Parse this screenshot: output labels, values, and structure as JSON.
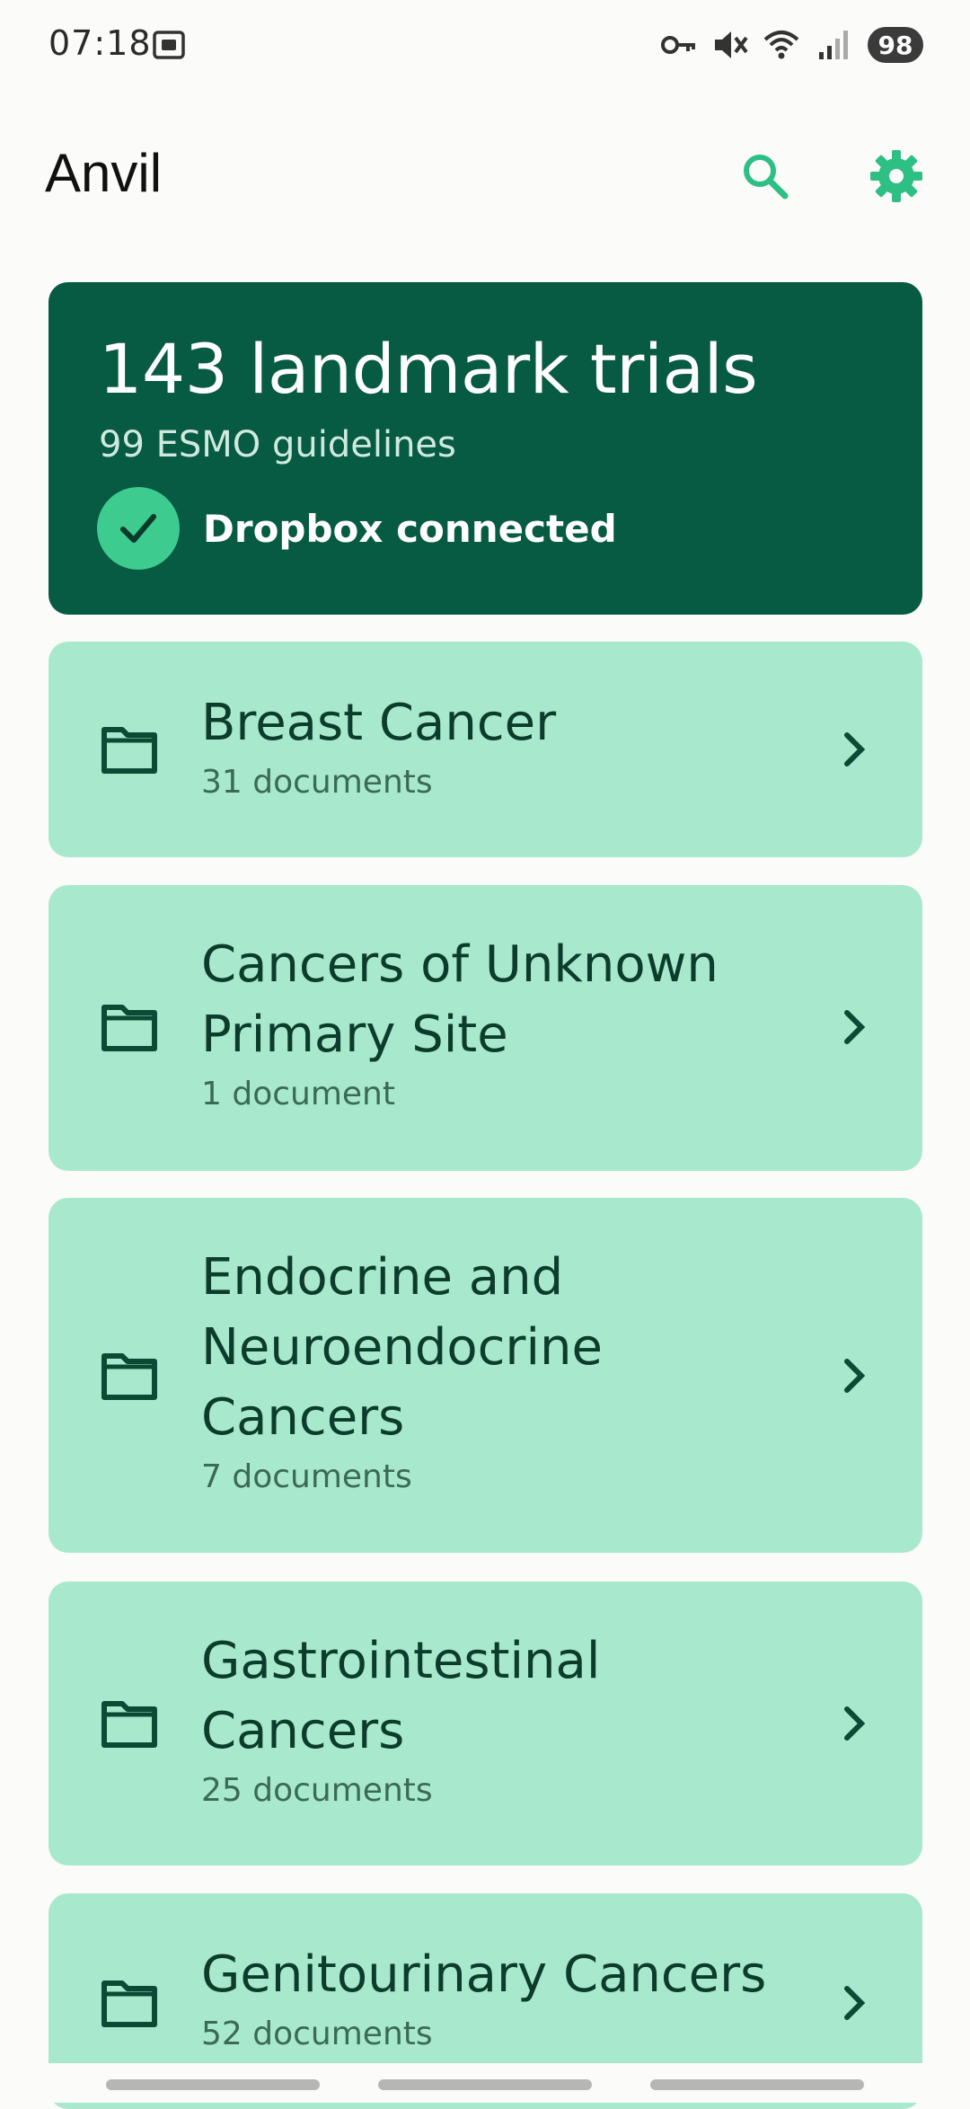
{
  "status_bar": {
    "time": "07:18",
    "battery": "98",
    "icons": [
      "screenshot-icon",
      "vpn-key-icon",
      "mute-icon",
      "wifi-icon",
      "signal-icon"
    ]
  },
  "app_bar": {
    "title": "Anvil",
    "icons": [
      "search-icon",
      "gear-icon"
    ],
    "accent_color": "#2ebf85"
  },
  "summary": {
    "title": "143 landmark trials",
    "subtitle": "99 ESMO guidelines",
    "dropbox_status": "Dropbox connected",
    "background_color": "#075b42"
  },
  "categories": [
    {
      "name": "Breast Cancer",
      "count": "31 documents"
    },
    {
      "name": "Cancers of Unknown Primary Site",
      "count": "1 document"
    },
    {
      "name": "Endocrine and Neuroendocrine Cancers",
      "count": "7 documents"
    },
    {
      "name": "Gastrointestinal Cancers",
      "count": "25 documents"
    },
    {
      "name": "Genitourinary Cancers",
      "count": "52 documents"
    }
  ],
  "card_color": "#a8e9cd"
}
